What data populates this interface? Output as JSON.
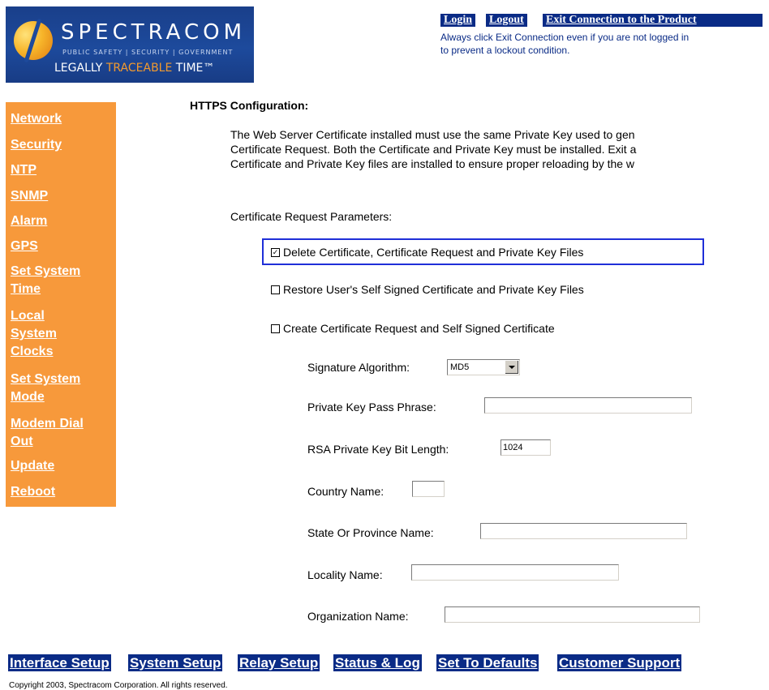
{
  "logo": {
    "name": "SPECTRACOM",
    "subtitle": "PUBLIC SAFETY | SECURITY | GOVERNMENT",
    "tagline_a": "LEGALLY ",
    "tagline_b": "TRACEABLE",
    "tagline_c": " TIME™"
  },
  "top_links": {
    "login": "Login",
    "logout": "Logout",
    "exit": "Exit Connection to the Product"
  },
  "top_note": {
    "line1": "Always click Exit Connection even if you are not logged in",
    "line2": "to prevent a lockout condition."
  },
  "sidebar": {
    "items": [
      {
        "label": "Network"
      },
      {
        "label": "Security"
      },
      {
        "label": "NTP"
      },
      {
        "label": "SNMP"
      },
      {
        "label": "Alarm"
      },
      {
        "label": "GPS"
      },
      {
        "label_l1": "Set System",
        "label_l2": "Time"
      },
      {
        "label_l1": "Local",
        "label_l2": "System",
        "label_l3": "Clocks"
      },
      {
        "label_l1": "Set System",
        "label_l2": "Mode"
      },
      {
        "label_l1": "Modem Dial",
        "label_l2": "Out"
      },
      {
        "label": "Update"
      },
      {
        "label": "Reboot"
      }
    ]
  },
  "main": {
    "title": "HTTPS Configuration:",
    "intro_line1": "The Web Server Certificate installed must use the same Private Key used to gen",
    "intro_line2": "Certificate Request. Both the Certificate and Private Key must be installed. Exit a",
    "intro_line3": "Certificate and Private Key files are installed to ensure proper reloading by the w",
    "params_label": "Certificate Request Parameters:",
    "options": [
      {
        "label": "Delete Certificate, Certificate Request and Private Key Files",
        "checked": true
      },
      {
        "label": "Restore User's Self Signed Certificate and Private Key Files",
        "checked": false
      },
      {
        "label": "Create Certificate Request and Self Signed Certificate",
        "checked": false
      }
    ],
    "fields": {
      "signature_algorithm": {
        "label": "Signature Algorithm:",
        "value": "MD5"
      },
      "pass_phrase": {
        "label": "Private Key Pass Phrase:",
        "value": ""
      },
      "rsa_bits": {
        "label": "RSA Private Key Bit Length:",
        "value": "1024"
      },
      "country": {
        "label": "Country Name:",
        "value": ""
      },
      "state": {
        "label": "State Or Province Name:",
        "value": ""
      },
      "locality": {
        "label": "Locality Name:",
        "value": ""
      },
      "organization": {
        "label": "Organization Name:",
        "value": ""
      }
    }
  },
  "bottom_nav": {
    "interface_setup": "Interface Setup",
    "system_setup": "System Setup",
    "relay_setup": "Relay Setup",
    "status_log": "Status & Log",
    "set_defaults": "Set To Defaults",
    "customer_support": "Customer Support"
  },
  "copyright": "Copyright 2003, Spectracom Corporation. All rights reserved.",
  "colors": {
    "sidebar": "#f7993b",
    "link_bg": "#0a2b86",
    "highlight_border": "#1f2fd8"
  }
}
